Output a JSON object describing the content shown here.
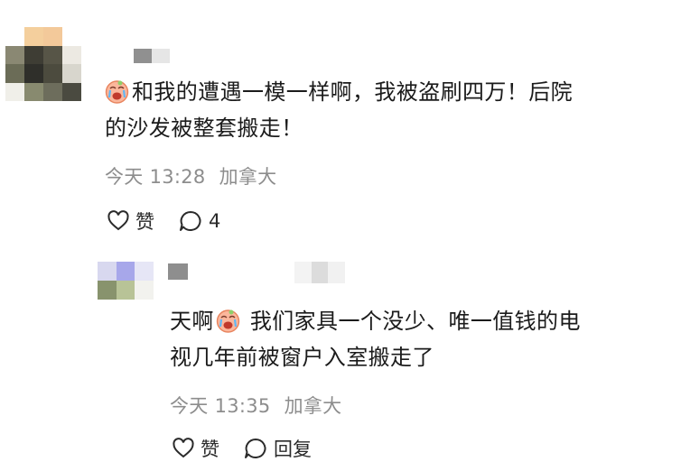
{
  "comment_main": {
    "text": "和我的遭遇一模一样啊，我被盗刷四万！后院的沙发被整套搬走！",
    "line1": "和我的遭遇一模一样啊，我被盗刷四万！后院",
    "line2": "的沙发被整套搬走！",
    "emoji": "crying-face-emoji",
    "time": "今天 13:28",
    "location": "加拿大",
    "like_label": "赞",
    "reply_count": "4"
  },
  "reply": {
    "prefix": "天啊",
    "line1_rest": " 我们家具一个没少、唯一值钱的电",
    "line2": "视几年前被窗户入室搬走了",
    "emoji": "crying-face-emoji",
    "time": "今天 13:35",
    "location": "加拿大",
    "like_label": "赞",
    "reply_label": "回复"
  },
  "colors": {
    "text": "#1b1b1b",
    "meta": "#8d8d8d",
    "icon": "#2a2a2a"
  },
  "avatars": {
    "main_mosaic": [
      "#ffffff",
      "#f4cf9d",
      "#f3c99a",
      "#ffffff",
      "#8a8873",
      "#3e3d34",
      "#575547",
      "#ece9e2",
      "#6b6c57",
      "#2f2f2a",
      "#4c4b3e",
      "#d8d6cd",
      "#f0efe9",
      "#888a6f",
      "#6d6d5c",
      "#4a4a40"
    ],
    "reply_mosaic": [
      "#d8d8ef",
      "#a7a7ea",
      "#e6e6f6",
      "#88936d",
      "#b8c397",
      "#f2f2ee"
    ]
  }
}
